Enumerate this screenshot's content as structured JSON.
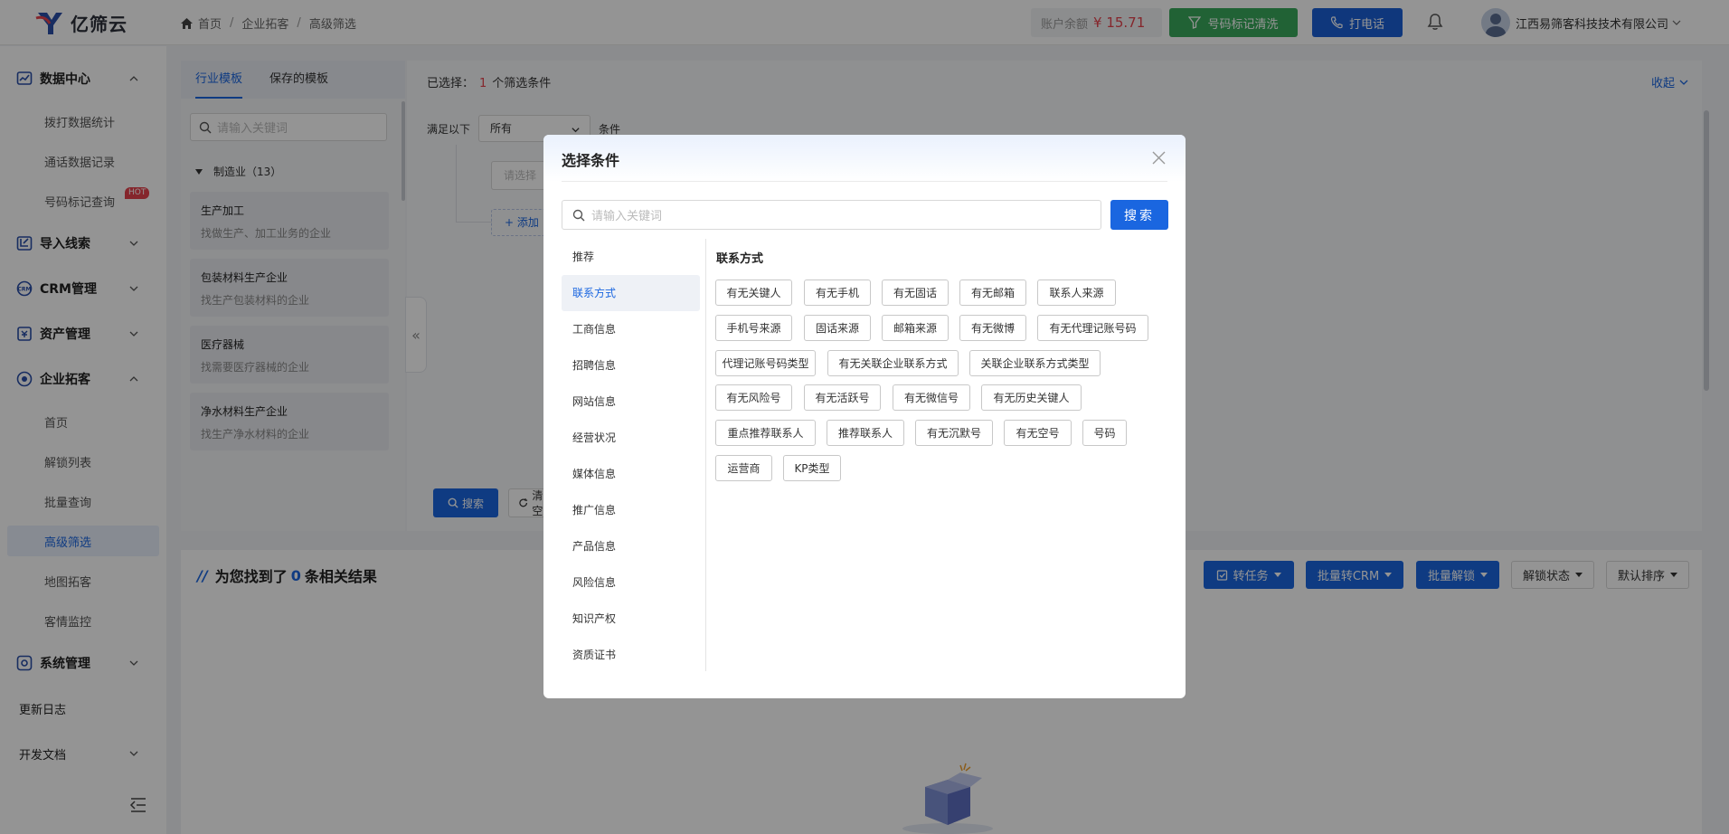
{
  "app": {
    "name": "亿筛云"
  },
  "breadcrumb": [
    "首页",
    "企业拓客",
    "高级筛选"
  ],
  "header": {
    "balance_label": "账户余额",
    "balance_value": "¥ 15.71",
    "clean_button": "号码标记清洗",
    "call_button": "打电话",
    "company": "江西易筛客科技技术有限公司"
  },
  "sidebar": {
    "groups": [
      {
        "label": "数据中心",
        "icon": "chart-icon",
        "expanded": true,
        "items": [
          "拨打数据统计",
          "通话数据记录",
          "号码标记查询"
        ]
      },
      {
        "label": "导入线索",
        "icon": "import-icon",
        "expanded": false
      },
      {
        "label": "CRM管理",
        "icon": "crm-icon",
        "expanded": false
      },
      {
        "label": "资产管理",
        "icon": "asset-icon",
        "expanded": false
      },
      {
        "label": "企业拓客",
        "icon": "compass-icon",
        "expanded": true,
        "items": [
          "首页",
          "解锁列表",
          "批量查询",
          "高级筛选",
          "地图拓客",
          "客情监控"
        ]
      },
      {
        "label": "系统管理",
        "icon": "settings-icon",
        "expanded": false
      }
    ],
    "hot_badge": "HOT",
    "changelog": "更新日志",
    "dev_docs": "开发文档",
    "active_item": "高级筛选"
  },
  "template_panel": {
    "tabs": [
      "行业模板",
      "保存的模板"
    ],
    "active_tab": "行业模板",
    "search_placeholder": "请输入关键词",
    "category": "制造业（13）",
    "cards": [
      {
        "title": "生产加工",
        "desc": "找做生产、加工业务的企业"
      },
      {
        "title": "包装材料生产企业",
        "desc": "找生产包装材料的企业"
      },
      {
        "title": "医疗器械",
        "desc": "找需要医疗器械的企业"
      },
      {
        "title": "净水材料生产企业",
        "desc": "找生产净水材料的企业"
      }
    ]
  },
  "filter_panel": {
    "selected_prefix": "已选择：",
    "selected_count": "1",
    "selected_suffix": "个筛选条件",
    "fold_label": "收起",
    "satisfy_label": "满足以下",
    "satisfy_value": "所有",
    "condition_label": "条件",
    "condition_placeholder": "请选择条件",
    "add_label": "添加",
    "search_button": "搜索",
    "clear_button": "清空"
  },
  "results": {
    "prefix": "为您找到了",
    "count": "0",
    "suffix": "条相关结果",
    "buttons": [
      "转任务",
      "批量转CRM",
      "批量解锁",
      "解锁状态",
      "默认排序"
    ]
  },
  "modal": {
    "title": "选择条件",
    "search_placeholder": "请输入关键词",
    "search_button": "搜索",
    "categories": [
      "推荐",
      "联系方式",
      "工商信息",
      "招聘信息",
      "网站信息",
      "经营状况",
      "媒体信息",
      "推广信息",
      "产品信息",
      "风险信息",
      "知识产权",
      "资质证书"
    ],
    "active_category": "联系方式",
    "section_title": "联系方式",
    "tags": [
      [
        "有无关键人",
        "有无手机",
        "有无固话",
        "有无邮箱",
        "联系人来源"
      ],
      [
        "手机号来源",
        "固话来源",
        "邮箱来源",
        "有无微博",
        "有无代理记账号码"
      ],
      [
        "代理记账号码类型",
        "有无关联企业联系方式",
        "关联企业联系方式类型"
      ],
      [
        "有无风险号",
        "有无活跃号",
        "有无微信号",
        "有无历史关键人"
      ],
      [
        "重点推荐联系人",
        "推荐联系人",
        "有无沉默号",
        "有无空号",
        "号码"
      ],
      [
        "运营商",
        "KP类型"
      ]
    ]
  },
  "colors": {
    "primary": "#1a66e0",
    "green": "#3aaa5c",
    "danger": "#e5424d"
  }
}
